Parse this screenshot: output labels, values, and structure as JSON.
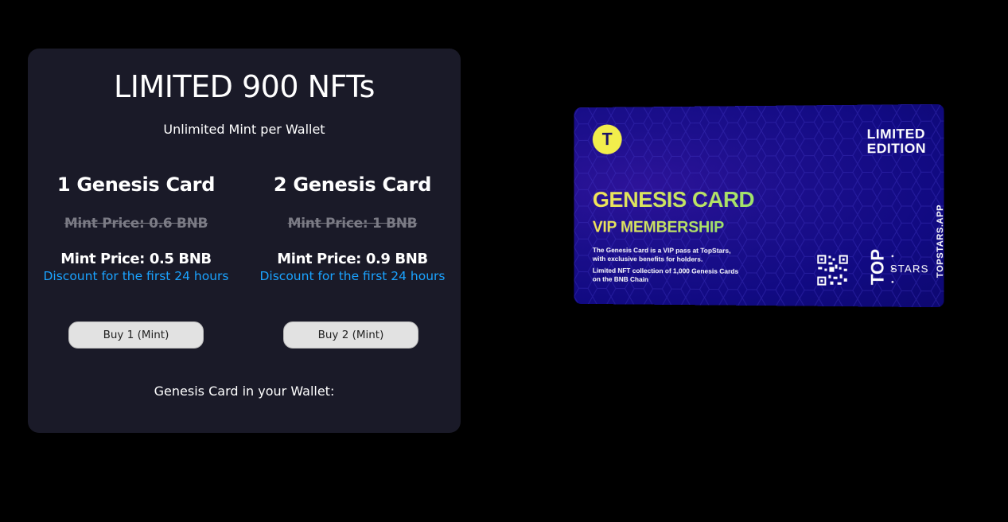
{
  "panel": {
    "title": "LIMITED 900 NFTs",
    "subtitle": "Unlimited Mint per Wallet",
    "options": [
      {
        "name": "1 Genesis Card",
        "old_price": "Mint Price: 0.6 BNB",
        "new_price": "Mint Price: 0.5 BNB",
        "discount": "Discount for the first 24 hours",
        "button": "Buy 1 (Mint)"
      },
      {
        "name": "2 Genesis Card",
        "old_price": "Mint Price: 1 BNB",
        "new_price": "Mint Price: 0.9 BNB",
        "discount": "Discount for the first 24 hours",
        "button": "Buy 2 (Mint)"
      }
    ],
    "wallet_label": "Genesis Card in your Wallet:"
  },
  "card": {
    "logo_letter": "T",
    "limited_line1": "LIMITED",
    "limited_line2": "EDITION",
    "site": "TOPSTARS.APP",
    "title": "GENESIS CARD",
    "subtitle": "VIP MEMBERSHIP",
    "desc1_line1": "The Genesis Card is a VIP pass at TopStars,",
    "desc1_line2": "with exclusive benefits for holders.",
    "desc2_line1": "Limited NFT collection of 1,000 Genesis Cards",
    "desc2_line2": "on the BNB Chain",
    "brand_top": "TOP",
    "brand_stars": "STARS"
  },
  "colors": {
    "page_bg": "#000000",
    "panel_bg": "#1a1a28",
    "discount": "#1aa3ff",
    "old_price": "#7b7b85",
    "button_bg": "#e2e2e2",
    "card_bg": "#110a82",
    "card_accent": "#f4e45a"
  },
  "icons": [
    "topstars-logo-icon",
    "qr-code-icon"
  ]
}
